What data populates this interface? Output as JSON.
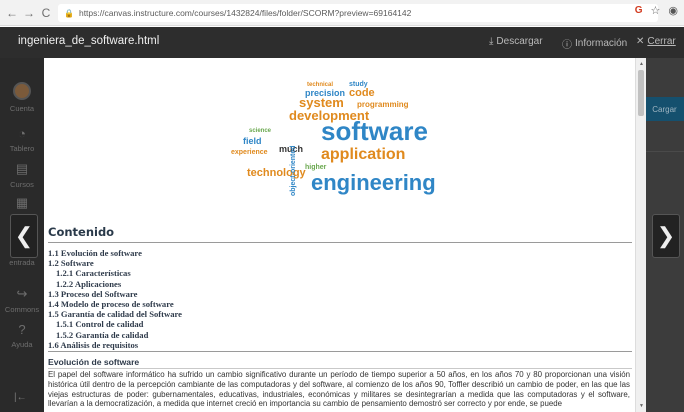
{
  "browser": {
    "url": "https://canvas.instructure.com/courses/1432824/files/folder/SCORM?preview=69164142",
    "back_icon": "←",
    "forward_icon": "→",
    "reload_icon": "C",
    "lock_icon": "🔒",
    "extension_icon": "G",
    "star_icon": "☆",
    "profile_icon": "◉"
  },
  "modal": {
    "title": "ingeniera_de_software.html",
    "download_label": "Descargar",
    "download_icon": "⤓",
    "info_label": "Información",
    "info_icon": "ⓘ",
    "close_label": "Cerrar",
    "close_icon": "✕",
    "prev_icon": "❮",
    "next_icon": "❯"
  },
  "sidebar": {
    "items": [
      {
        "label": "Cuenta",
        "icon": ""
      },
      {
        "label": "Tablero",
        "icon": "◔"
      },
      {
        "label": "Cursos",
        "icon": "▤"
      },
      {
        "label": "",
        "icon": "▦"
      },
      {
        "label": "entrada",
        "icon": ""
      },
      {
        "label": "Commons",
        "icon": "↪"
      },
      {
        "label": "Ayuda",
        "icon": "?"
      }
    ],
    "collapse_icon": "|←"
  },
  "background": {
    "cargar_label": "Cargar"
  },
  "document": {
    "wordcloud": {
      "big_words": [
        "software",
        "engineering",
        "application",
        "development",
        "system",
        "code",
        "technology",
        "programming",
        "precision",
        "study",
        "technical",
        "object-oriented",
        "higher",
        "much",
        "field",
        "experience",
        "science"
      ]
    },
    "contenido_title": "Contenido",
    "toc": [
      {
        "text": "1.1 Evolución de software",
        "level": 1
      },
      {
        "text": "1.2 Software",
        "level": 1
      },
      {
        "text": "1.2.1 Características",
        "level": 2
      },
      {
        "text": "1.2.2 Aplicaciones",
        "level": 2
      },
      {
        "text": "1.3 Proceso del Software",
        "level": 1
      },
      {
        "text": "1.4 Modelo de proceso de software",
        "level": 1
      },
      {
        "text": "1.5 Garantía de calidad del Software",
        "level": 1
      },
      {
        "text": "1.5.1 Control de calidad",
        "level": 2
      },
      {
        "text": "1.5.2 Garantía de calidad",
        "level": 2
      },
      {
        "text": "1.6 Análisis de requisitos",
        "level": 1
      }
    ],
    "section_heading": "Evolución de software",
    "paragraph": "El papel del software informático ha sufrido un cambio significativo durante un período  de tiempo superior a 50 años, en los años 70 y 80 proporcionan una visión histórica útil dentro de la percepción cambiante de las computadoras y del software, al comienzo de los años 90, Toffler describió un cambio de poder, en las que las viejas estructuras de poder: gubernamentales, educativas, industriales, económicas y militares se desintegrarían a medida que las computadoras y el software, llevarían a la democratización, a medida que internet creció en importancia su cambio de pensamiento demostró ser correcto y por ende, se puede"
  },
  "colors": {
    "modal_header": "#2d2d2d",
    "backdrop": "#393939",
    "wordcloud_blue": "#2f86c6",
    "wordcloud_orange": "#e08a1e",
    "wordcloud_green": "#6aa84f"
  }
}
